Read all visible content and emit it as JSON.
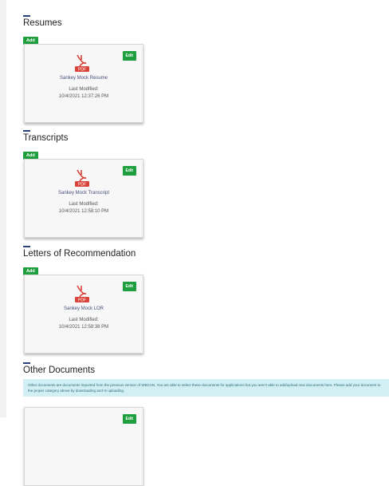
{
  "sections": [
    {
      "title": "Resumes",
      "add_label": "Add",
      "card": {
        "edit_label": "Edit",
        "file_type": "PDF",
        "name": "Sankey Mock Resume",
        "modified_label": "Last Modified:",
        "modified_date": "10/4/2021 12:37:26 PM"
      }
    },
    {
      "title": "Transcripts",
      "add_label": "Add",
      "card": {
        "edit_label": "Edit",
        "file_type": "PDF",
        "name": "Sankey Mock Transcript",
        "modified_label": "Last Modified:",
        "modified_date": "10/4/2021 12:58:10 PM"
      }
    },
    {
      "title": "Letters of Recommendation",
      "add_label": "Add",
      "card": {
        "edit_label": "Edit",
        "file_type": "PDF",
        "name": "Sankey Mock LOR",
        "modified_label": "Last Modified:",
        "modified_date": "10/4/2021 12:58:38 PM"
      }
    },
    {
      "title": "Other Documents",
      "info_text": "Other documents are documents imported from the previous version of WBCAN. You are able to select these documents for applications but you aren't able to add/upload new documents here. Please add your document to the proper category above by downloading and re uploading.",
      "card": {
        "edit_label": "Edit"
      }
    }
  ],
  "colors": {
    "accent_green": "#1e9e3e",
    "pdf_red": "#d9443a",
    "link_blue": "#4a4f7d",
    "info_bg": "#d2eff4"
  },
  "icons": {
    "document": "pdf-file-icon"
  }
}
